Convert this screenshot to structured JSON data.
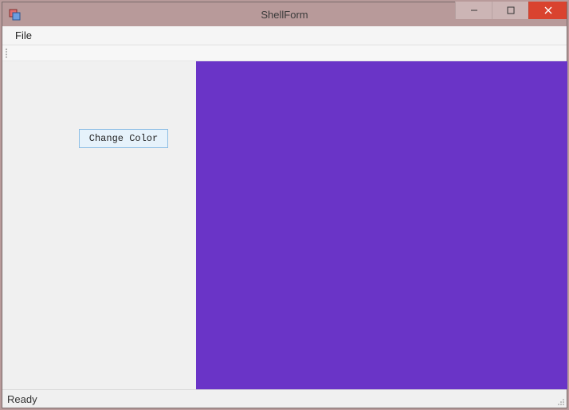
{
  "window": {
    "title": "ShellForm"
  },
  "menu": {
    "file": "File"
  },
  "controls": {
    "change_color_label": "Change Color"
  },
  "status": {
    "text": "Ready"
  },
  "colors": {
    "panel_color": "#6a34c7"
  }
}
